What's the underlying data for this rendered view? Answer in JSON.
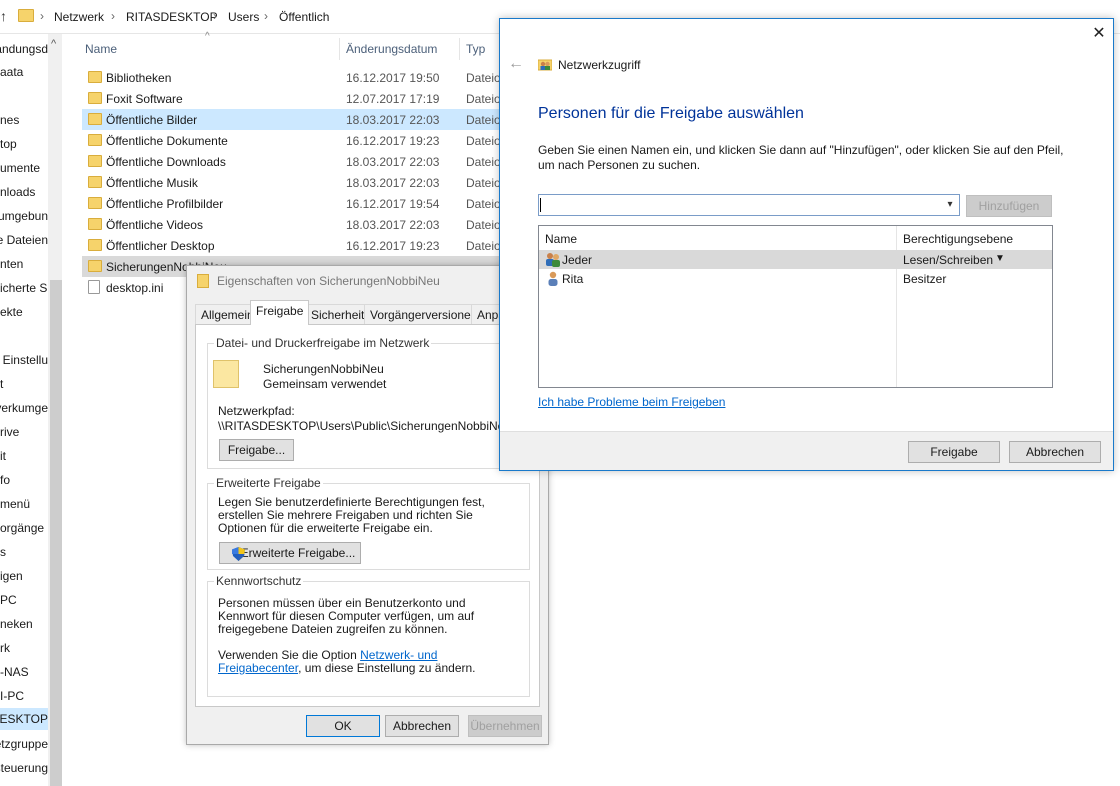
{
  "explorer": {
    "breadcrumbs": [
      "Netzwerk",
      "RITASDESKTOP",
      "Users",
      "Öffentlich"
    ],
    "columns": {
      "name": "Name",
      "date": "Änderungsdatum",
      "type": "Typ"
    },
    "nav_items": [
      {
        "label": "Bandungsd"
      },
      {
        "label": "aata"
      },
      {
        "label": "nes"
      },
      {
        "label": "top"
      },
      {
        "label": "umente"
      },
      {
        "label": "nloads"
      },
      {
        "label": "umgebun"
      },
      {
        "label": "e Dateien"
      },
      {
        "label": "nten"
      },
      {
        "label": "icherte S"
      },
      {
        "label": "ekte"
      },
      {
        "label": "e Einstellu"
      },
      {
        "label": "t"
      },
      {
        "label": "verkumge"
      },
      {
        "label": "rive"
      },
      {
        "label": "it"
      },
      {
        "label": "fo"
      },
      {
        "label": "menü"
      },
      {
        "label": "orgänge"
      },
      {
        "label": "s"
      },
      {
        "label": "igen"
      },
      {
        "label": "PC"
      },
      {
        "label": "neken"
      },
      {
        "label": "rk"
      },
      {
        "label": "-NAS"
      },
      {
        "label": "I-PC"
      },
      {
        "label": "DESKTOP"
      },
      {
        "label": "etzgruppe"
      },
      {
        "label": "steuerung"
      }
    ],
    "files": [
      {
        "name": "Bibliotheken",
        "date": "16.12.2017 19:50",
        "type": "Dateio"
      },
      {
        "name": "Foxit Software",
        "date": "12.07.2017 17:19",
        "type": "Dateio"
      },
      {
        "name": "Öffentliche Bilder",
        "date": "18.03.2017 22:03",
        "type": "Dateio"
      },
      {
        "name": "Öffentliche Dokumente",
        "date": "16.12.2017 19:23",
        "type": "Dateio"
      },
      {
        "name": "Öffentliche Downloads",
        "date": "18.03.2017 22:03",
        "type": "Dateio"
      },
      {
        "name": "Öffentliche Musik",
        "date": "18.03.2017 22:03",
        "type": "Dateio"
      },
      {
        "name": "Öffentliche Profilbilder",
        "date": "16.12.2017 19:54",
        "type": "Dateio"
      },
      {
        "name": "Öffentliche Videos",
        "date": "18.03.2017 22:03",
        "type": "Dateio"
      },
      {
        "name": "Öffentlicher Desktop",
        "date": "16.12.2017 19:23",
        "type": "Dateio"
      },
      {
        "name": "SicherungenNobbiNeu",
        "date": "",
        "type": ""
      },
      {
        "name": "desktop.ini",
        "date": "",
        "type": ""
      }
    ]
  },
  "properties": {
    "title": "Eigenschaften von SicherungenNobbiNeu",
    "tabs": [
      "Allgemein",
      "Freigabe",
      "Sicherheit",
      "Vorgängerversionen",
      "Anpa"
    ],
    "share_group": {
      "title": "Datei- und Druckerfreigabe im Netzwerk",
      "folder_name": "SicherungenNobbiNeu",
      "folder_status": "Gemeinsam verwendet",
      "path_label": "Netzwerkpfad:",
      "path_value": "\\\\RITASDESKTOP\\Users\\Public\\SicherungenNobbiNeu",
      "button": "Freigabe..."
    },
    "advanced_group": {
      "title": "Erweiterte Freigabe",
      "text": "Legen Sie benutzerdefinierte Berechtigungen fest, erstellen Sie mehrere Freigaben und richten Sie Optionen für die erweiterte Freigabe ein.",
      "button": "Erweiterte Freigabe..."
    },
    "password_group": {
      "title": "Kennwortschutz",
      "text": "Personen müssen über ein Benutzerkonto und Kennwort für diesen Computer verfügen, um auf freigegebene Dateien zugreifen zu können.",
      "text2_prefix": "Verwenden Sie die Option ",
      "text2_link": "Netzwerk- und Freigabecenter",
      "text2_suffix": ", um diese Einstellung zu ändern."
    },
    "buttons": {
      "ok": "OK",
      "cancel": "Abbrechen",
      "apply": "Übernehmen"
    }
  },
  "network_access": {
    "title": "Netzwerkzugriff",
    "heading": "Personen für die Freigabe auswählen",
    "description": "Geben Sie einen Namen ein, und klicken Sie dann auf \"Hinzufügen\", oder klicken Sie auf den Pfeil, um nach Personen zu suchen.",
    "name_input_value": "",
    "add_button": "Hinzufügen",
    "list_headers": {
      "name": "Name",
      "permission": "Berechtigungsebene"
    },
    "users": [
      {
        "name": "Jeder",
        "permission": "Lesen/Schreiben"
      },
      {
        "name": "Rita",
        "permission": "Besitzer"
      }
    ],
    "help_link": "Ich habe Probleme beim Freigeben",
    "buttons": {
      "share": "Freigabe",
      "cancel": "Abbrechen"
    }
  },
  "icons": {
    "up": "up-arrow-icon",
    "folder": "folder-icon",
    "shield": "uac-shield-icon",
    "group_user": "group-user-icon",
    "user": "user-icon",
    "close": "close-icon",
    "back": "back-arrow-icon",
    "dropdown": "chevron-down-icon"
  },
  "colors": {
    "accent": "#0078d7",
    "heading": "#003399",
    "selection": "#cce8ff",
    "link": "#0066cc",
    "folder": "#f6d36b"
  }
}
